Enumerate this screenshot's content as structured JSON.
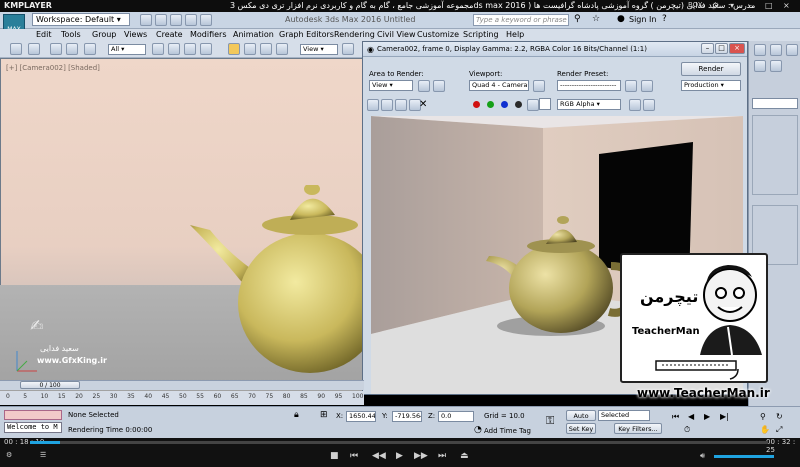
{
  "player": {
    "brand": "KMPLAYER",
    "title": "مجموعه آموزشی جامع ، گام به گام و کاربردی نرم افزار تری دی مکس 3ds max 2016 ) مدرس : سعید فدایی (تیچرمن ) گروه آموزشی پادشاه گرافیست ها",
    "box_label": "BOX",
    "current_time": "00 : 18 : 10",
    "total_time": "00 : 32 : 25",
    "progress": 0.04
  },
  "max": {
    "logo_label": "MAX",
    "workspace": "Workspace: Default",
    "app_title": "Autodesk 3ds Max 2016    Untitled",
    "search_placeholder": "Type a keyword or phrase",
    "sign_in": "Sign In",
    "menus": [
      "Edit",
      "Tools",
      "Group",
      "Views",
      "Create",
      "Modifiers",
      "Animation",
      "Graph Editors",
      "Rendering",
      "Civil View",
      "Customize",
      "Scripting",
      "Help"
    ],
    "selection_filter": "All",
    "view_dropdown": "View",
    "viewport_label": "[+] [Camera002] [Shaded]"
  },
  "render_window": {
    "title": "Camera002, frame 0, Display Gamma: 2.2, RGBA Color 16 Bits/Channel (1:1)",
    "area_label": "Area to Render:",
    "area_value": "View",
    "viewport_label": "Viewport:",
    "viewport_value": "Quad 4 - Camera0",
    "preset_label": "Render Preset:",
    "preset_value": "------------------------",
    "render_button": "Render",
    "production_value": "Production",
    "channel_value": "RGB Alpha",
    "colors": [
      "#d01010",
      "#15a018",
      "#1030d0",
      "#2a2a2a"
    ]
  },
  "timeline": {
    "frame_counter": "0 / 100",
    "ticks": [
      "0",
      "5",
      "10",
      "15",
      "20",
      "25",
      "30",
      "35",
      "40",
      "45",
      "50",
      "55",
      "60",
      "65",
      "70",
      "75",
      "80",
      "85",
      "90",
      "95",
      "100"
    ]
  },
  "status": {
    "maxscript": "Welcome to M",
    "selection": "None Selected",
    "rendering_time": "Rendering Time  0:00:00",
    "x": "1650.441",
    "y": "-719.564",
    "z": "0.0",
    "grid": "Grid = 10.0",
    "add_time_tag": "Add Time Tag",
    "auto_key": "Auto Key",
    "selected": "Selected",
    "set_key": "Set Key",
    "key_filters": "Key Filters..."
  },
  "watermark": {
    "name": "سعید فدایی",
    "url": "www.GfxKing.ir"
  },
  "teacher": {
    "fa_name": "تیچرمن",
    "en_name": "TeacherMan",
    "url": "www.TeacherMan.ir"
  }
}
